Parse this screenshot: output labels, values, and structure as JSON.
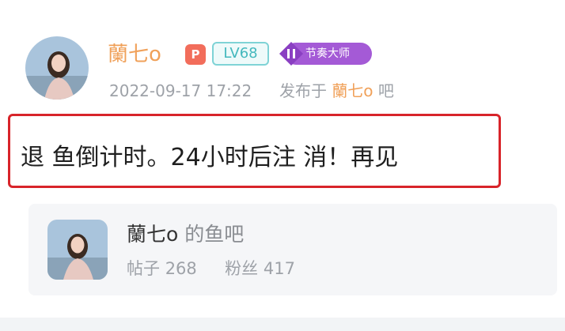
{
  "post": {
    "username": "蘭七o",
    "badge_p": "P",
    "level_badge": "LV68",
    "title_badge": "节奏大师",
    "timestamp": "2022-09-17 17:22",
    "posted_in_prefix": "发布于",
    "bar_name": "蘭七o",
    "bar_suffix": "吧",
    "content": "退 鱼倒计时。24小时后注 消！再见"
  },
  "bar_card": {
    "name": "蘭七o",
    "suffix": "的鱼吧",
    "posts_label": "帖子",
    "posts_count": "268",
    "fans_label": "粉丝",
    "fans_count": "417"
  },
  "colors": {
    "username": "#f0a15a",
    "highlight_border": "#d8242a",
    "level_badge": "#43b8bd",
    "title_badge": "#a45ad6"
  }
}
